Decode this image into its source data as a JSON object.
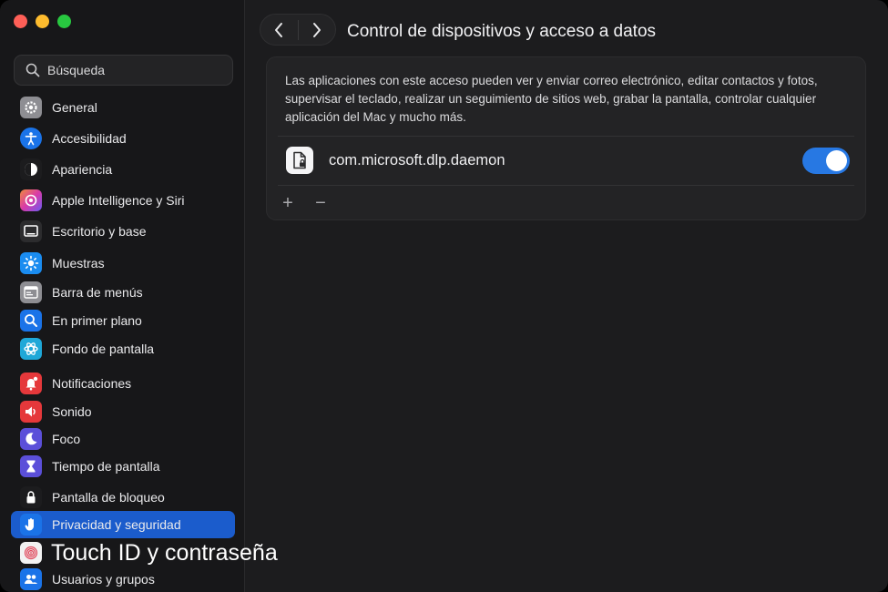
{
  "window": {
    "title": "Control de dispositivos y acceso a datos"
  },
  "search": {
    "placeholder": "Búsqueda"
  },
  "sidebar": {
    "items": [
      {
        "label": "General",
        "icon": "gear-icon",
        "color": "#8e8e93"
      },
      {
        "label": "Accesibilidad",
        "icon": "accessibility-icon",
        "color": "#1a73e8"
      },
      {
        "label": "Apariencia",
        "icon": "appearance-icon",
        "color": "#1c1c1e"
      },
      {
        "label": "Apple Intelligence y Siri",
        "icon": "siri-icon",
        "color": "#c04ee0"
      },
      {
        "label": "Escritorio y base",
        "icon": "dock-icon",
        "color": "#2c2c2e"
      },
      {
        "label": "Muestras",
        "icon": "displays-icon",
        "color": "#1a8cf0"
      },
      {
        "label": "Barra de menús",
        "icon": "menu-bar-icon",
        "color": "#8e8e93"
      },
      {
        "label": "En primer plano",
        "icon": "spotlight-icon",
        "color": "#1a73e8"
      },
      {
        "label": "Fondo de pantalla",
        "icon": "wallpaper-icon",
        "color": "#1fa8d8"
      },
      {
        "label": "Notificaciones",
        "icon": "notifications-icon",
        "color": "#e5383b"
      },
      {
        "label": "Sonido",
        "icon": "sound-icon",
        "color": "#e5383b"
      },
      {
        "label": "Foco",
        "icon": "focus-moon-icon",
        "color": "#5b4fd9"
      },
      {
        "label": "Tiempo de pantalla",
        "icon": "hourglass-icon",
        "color": "#5b4fd9"
      },
      {
        "label": "Pantalla de bloqueo",
        "icon": "lock-icon",
        "color": "#1c1c1e"
      },
      {
        "label": "Privacidad y seguridad",
        "icon": "hand-icon",
        "color": "#1a73e8"
      },
      {
        "label": "Touch ID y contraseña",
        "icon": "fingerprint-icon",
        "color": "#f2f2f2"
      },
      {
        "label": "Usuarios y grupos",
        "icon": "users-icon",
        "color": "#1a73e8"
      }
    ],
    "selected": "Privacidad y seguridad"
  },
  "panel": {
    "description": "Las aplicaciones con este acceso pueden ver y enviar correo electrónico, editar contactos y fotos, supervisar el teclado, realizar un seguimiento de sitios web, grabar la pantalla, controlar cualquier aplicación del Mac y mucho más.",
    "apps": [
      {
        "name": "com.microsoft.dlp.daemon",
        "enabled": true
      }
    ],
    "add_symbol": "+",
    "remove_symbol": "−"
  },
  "colors": {
    "accent": "#1b5ccc",
    "toggle_on": "#2778e3"
  }
}
